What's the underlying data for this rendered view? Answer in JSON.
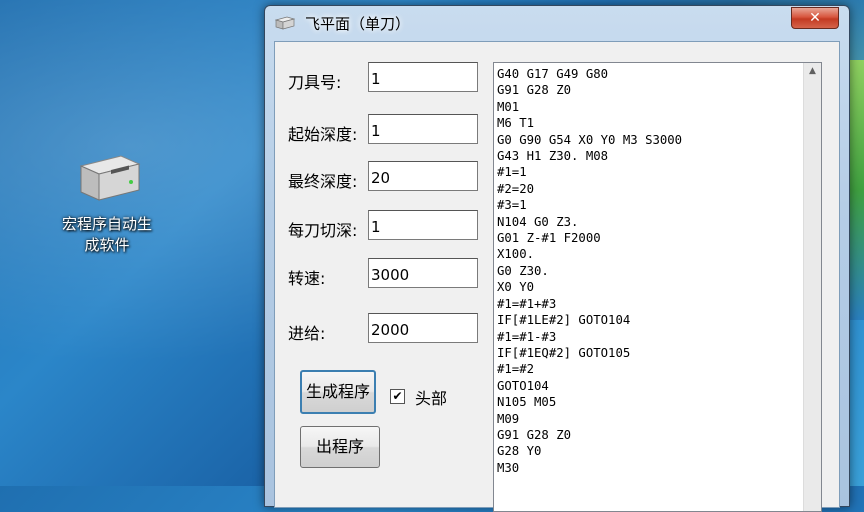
{
  "desktop": {
    "icon_label_line1": "宏程序自动生",
    "icon_label_line2": "成软件"
  },
  "window": {
    "title": "飞平面（单刀）",
    "close_glyph": "✕",
    "fields": [
      {
        "label": "刀具号:",
        "value": "1"
      },
      {
        "label": "起始深度:",
        "value": "1"
      },
      {
        "label": "最终深度:",
        "value": "20"
      },
      {
        "label": "每刀切深:",
        "value": "1"
      },
      {
        "label": "转速:",
        "value": "3000"
      },
      {
        "label": "进给:",
        "value": "2000"
      }
    ],
    "generate_button": "生成程序",
    "header_checkbox": {
      "label": "头部",
      "checked": true,
      "glyph": "✔"
    },
    "output_button": "出程序",
    "scroll_up_glyph": "▲",
    "code_lines": [
      "G40 G17 G49 G80",
      "G91 G28 Z0",
      "M01",
      "M6 T1",
      "G0 G90 G54 X0 Y0 M3 S3000",
      "G43 H1 Z30. M08",
      "#1=1",
      "#2=20",
      "#3=1",
      "N104 G0 Z3.",
      "G01 Z-#1 F2000",
      "X100.",
      "G0 Z30.",
      "X0 Y0",
      "#1=#1+#3",
      "IF[#1LE#2] GOTO104",
      "#1=#1-#3",
      "IF[#1EQ#2] GOTO105",
      "#1=#2",
      "GOTO104",
      "N105 M05",
      "M09",
      "G91 G28 Z0",
      "G28 Y0",
      "M30"
    ]
  }
}
